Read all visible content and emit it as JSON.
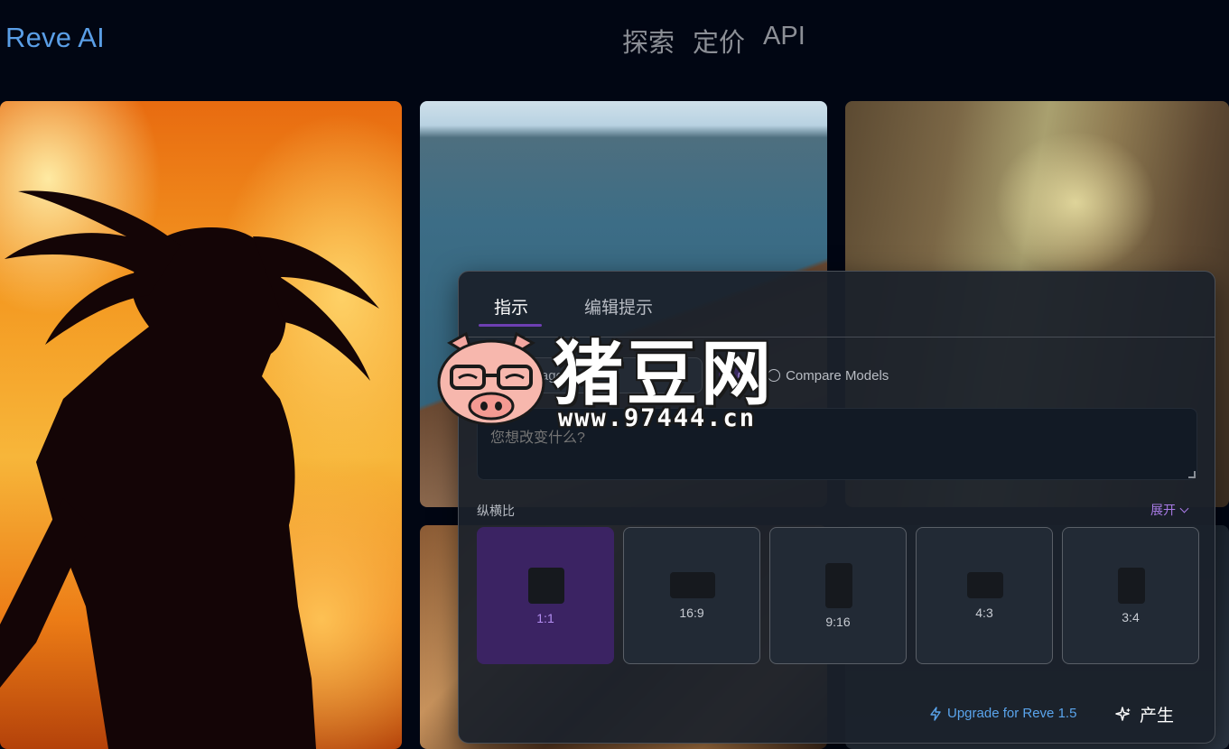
{
  "header": {
    "brand": "Reve AI",
    "nav": [
      "探索",
      "定价",
      "API"
    ]
  },
  "gallery": {
    "tiles": [
      "fire-silhouette",
      "coastal-cliffs",
      "stone-cottage",
      "metallic-art",
      "dark-scene"
    ]
  },
  "watermark": {
    "title": "猪豆网",
    "url": "www.97444.cn"
  },
  "panel": {
    "tabs": [
      {
        "label": "指示",
        "active": true
      },
      {
        "label": "编辑提示",
        "active": false
      }
    ],
    "model_select": "Reve Image",
    "model_badge": "1.0",
    "compare_label": "Compare Models",
    "prompt_placeholder": "您想改变什么?",
    "aspect_label": "纵横比",
    "expand_label": "展开",
    "ratios": [
      {
        "label": "1:1",
        "selected": true
      },
      {
        "label": "16:9",
        "selected": false
      },
      {
        "label": "9:16",
        "selected": false
      },
      {
        "label": "4:3",
        "selected": false
      },
      {
        "label": "3:4",
        "selected": false
      }
    ],
    "upgrade_label": "Upgrade for Reve 1.5",
    "generate_label": "产生"
  },
  "colors": {
    "brand": "#5a9ee6",
    "accent": "#6d3fb2",
    "link": "#5aa4ec",
    "expand": "#a97be6"
  }
}
